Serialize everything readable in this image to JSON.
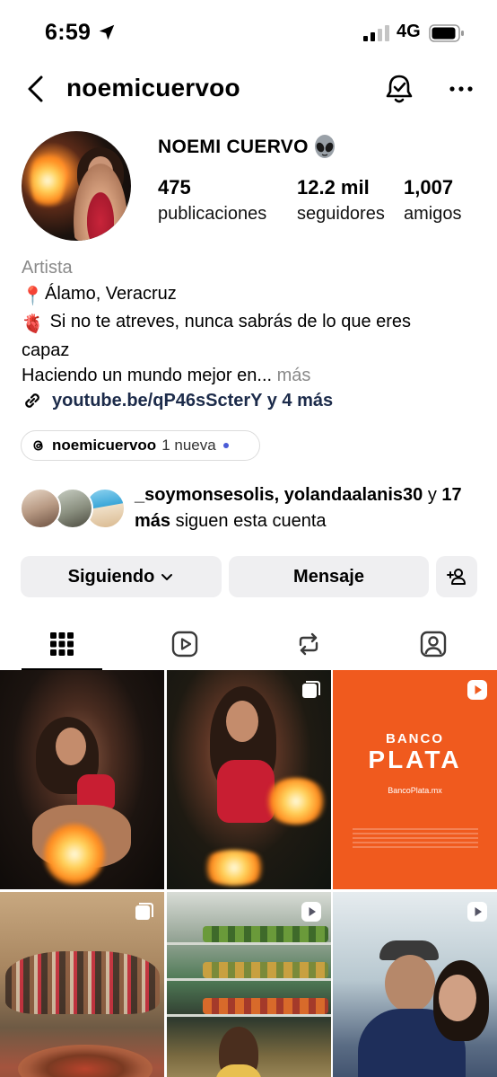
{
  "status_bar": {
    "time": "6:59",
    "network": "4G",
    "icons": [
      "location-arrow-icon",
      "signal-icon",
      "battery-icon"
    ]
  },
  "header": {
    "username": "noemicuervoo",
    "icons": [
      "back-icon",
      "bell-icon",
      "more-icon"
    ]
  },
  "profile": {
    "display_name": "NOEMI CUERVO",
    "name_emoji": "alien-icon",
    "stats": [
      {
        "value": "475",
        "label": "publicaciones"
      },
      {
        "value": "12.2 mil",
        "label": "seguidores"
      },
      {
        "value": "1,007",
        "label": "amigos"
      }
    ],
    "category": "Artista",
    "location_emoji": "📍",
    "location": "Álamo, Veracruz",
    "quote_emoji": "🫀",
    "quote_line1": "Si no te atreves, nunca sabrás de lo que eres",
    "quote_line2": "capaz",
    "bio_truncated": "Haciendo un mundo mejor en...",
    "more_label": "más",
    "link": "youtube.be/qP46sScterY y 4 más"
  },
  "threads": {
    "username": "noemicuervoo",
    "badge": "1 nueva"
  },
  "followed_by": {
    "names": "_soymonsesolis, yolandaalanis30",
    "connector": "y",
    "count": "17 más",
    "suffix": "siguen esta cuenta"
  },
  "actions": {
    "following_label": "Siguiendo",
    "message_label": "Mensaje"
  },
  "tabs": [
    "grid-icon",
    "reels-icon",
    "reposts-icon",
    "tagged-icon"
  ],
  "posts": {
    "banco_title_top": "BANCO",
    "banco_title_main": "PLATA",
    "banco_url": "BancoPlata.mx"
  }
}
